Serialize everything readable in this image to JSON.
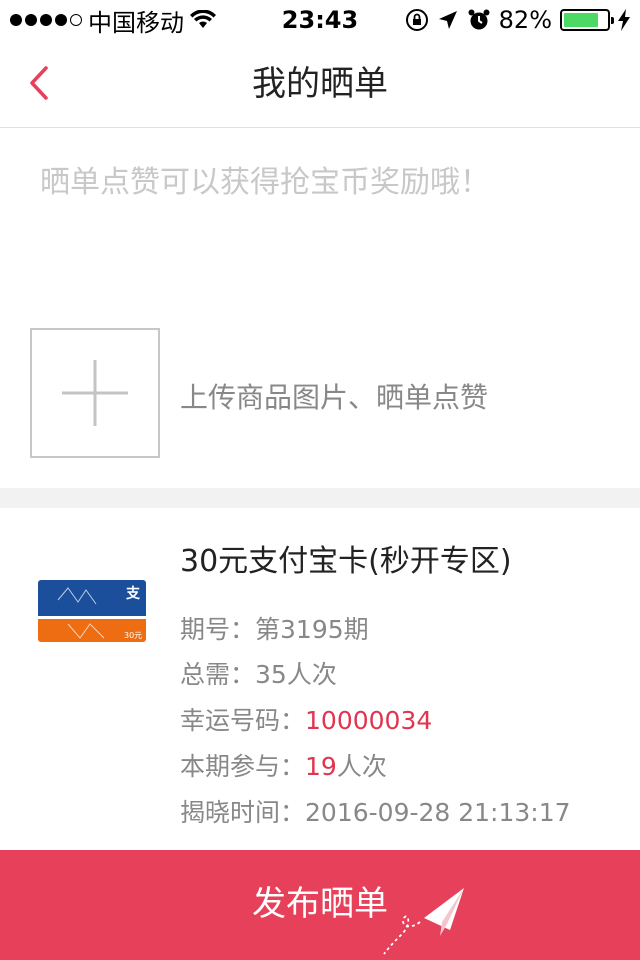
{
  "status_bar": {
    "carrier": "中国移动",
    "time": "23:43",
    "battery_percent": "82%",
    "battery_level": 0.82
  },
  "nav": {
    "title": "我的晒单"
  },
  "note": {
    "placeholder": "晒单点赞可以获得抢宝币奖励哦！"
  },
  "upload": {
    "label": "上传商品图片、晒单点赞"
  },
  "product": {
    "title": "30元支付宝卡(秒开专区)",
    "image_price": "30元",
    "period_label": "期号：",
    "period_value": "第3195期",
    "need_label": "总需：",
    "need_value": "35人次",
    "lucky_label": "幸运号码：",
    "lucky_value": "10000034",
    "join_label": "本期参与：",
    "join_count": "19",
    "join_unit": "人次",
    "reveal_label": "揭晓时间：",
    "reveal_value": "2016-09-28 21:13:17"
  },
  "actions": {
    "publish_label": "发布晒单"
  },
  "colors": {
    "accent": "#e6405a",
    "highlight": "#e0354f",
    "battery": "#4cd964"
  }
}
